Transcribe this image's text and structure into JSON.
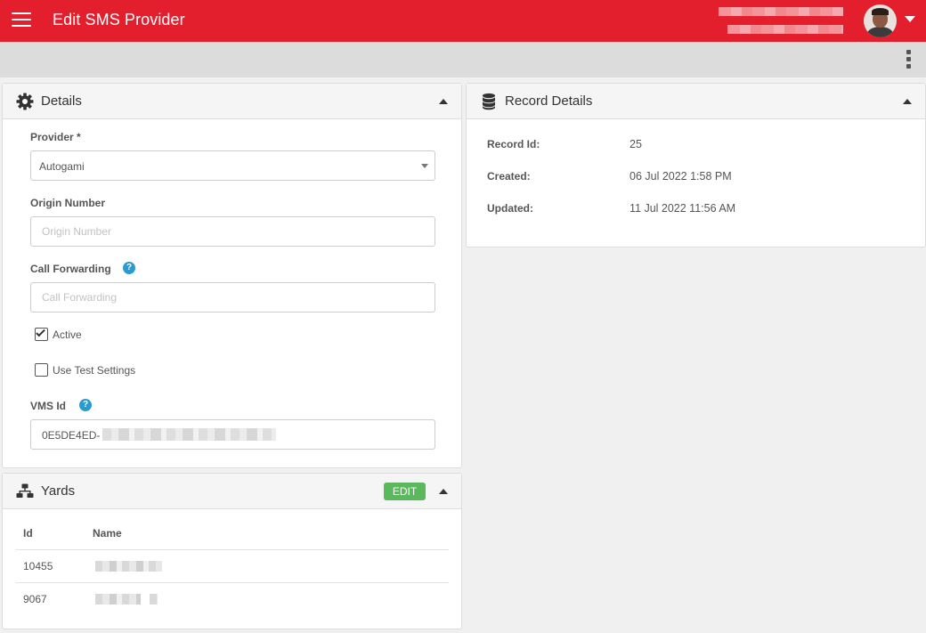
{
  "header": {
    "title": "Edit SMS Provider",
    "colors": {
      "brand": "#e31e2d"
    },
    "icons": {
      "menu": "hamburger-icon",
      "user": "avatar",
      "user_menu": "caret-down-icon",
      "more": "kebab-icon"
    }
  },
  "details": {
    "title": "Details",
    "icon": "gear-icon",
    "provider": {
      "label": "Provider *",
      "value": "Autogami"
    },
    "origin_number": {
      "label": "Origin Number",
      "placeholder": "Origin Number",
      "value": ""
    },
    "call_forwarding": {
      "label": "Call Forwarding",
      "placeholder": "Call Forwarding",
      "value": "",
      "help": "?"
    },
    "active": {
      "label": "Active",
      "checked": true
    },
    "use_test_settings": {
      "label": "Use Test Settings",
      "checked": false
    },
    "vms_id": {
      "label": "VMS Id",
      "value": "0E5DE4ED-",
      "help": "?"
    }
  },
  "record_details": {
    "title": "Record Details",
    "icon": "database-icon",
    "rows": [
      {
        "key": "Record Id:",
        "value": "25"
      },
      {
        "key": "Created:",
        "value": "06 Jul 2022 1:58 PM"
      },
      {
        "key": "Updated:",
        "value": "11 Jul 2022 11:56 AM"
      }
    ]
  },
  "yards": {
    "title": "Yards",
    "icon": "sitemap-icon",
    "edit_label": "EDIT",
    "edit_color": "#5cb85c",
    "columns": [
      "Id",
      "Name"
    ],
    "rows": [
      {
        "id": "10455",
        "name": ""
      },
      {
        "id": "9067",
        "name": ""
      }
    ]
  }
}
